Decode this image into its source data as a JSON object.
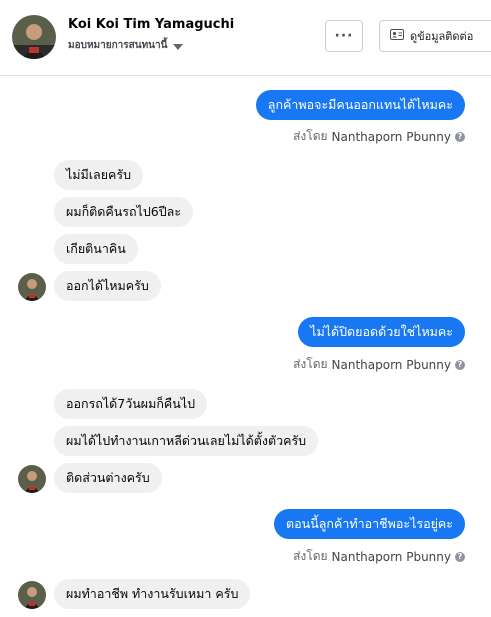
{
  "header": {
    "contact_name": "Koi Koi Tim Yamaguchi",
    "assign_label": "มอบหมายการสนทนานี้",
    "more_label": "···",
    "contact_info_label": "ดูข้อมูลติดต่อ",
    "more_icon": "ellipsis-icon",
    "contact_icon": "contact-card-icon"
  },
  "sent_by": {
    "prefix": "ส่งโดย",
    "agent": "Nanthaporn Pbunny",
    "info": "?"
  },
  "messages": [
    {
      "dir": "out",
      "text": "ลูกค้าพอจะมีคนออกแทนได้ไหมคะ"
    },
    {
      "dir": "in",
      "text": "ไม่มีเลยครับ"
    },
    {
      "dir": "in",
      "text": "ผมก็ติดคืนรถไป6ปีละ"
    },
    {
      "dir": "in",
      "text": "เกียตินาคิน"
    },
    {
      "dir": "in",
      "text": "ออกได้ไหมครับ"
    },
    {
      "dir": "out",
      "text": "ไม่ได้ปิดยอดด้วยใช่ไหมคะ"
    },
    {
      "dir": "in",
      "text": "ออกรถได้7วันผมก็คืนไป"
    },
    {
      "dir": "in",
      "text": "ผมได้ไปทำงานเกาหลีด่วนเลยไม่ได้ตั้งตัวครับ"
    },
    {
      "dir": "in",
      "text": "ติดส่วนต่างครับ"
    },
    {
      "dir": "out",
      "text": "ตอนนี้ลูกค้าทำอาชีพอะไรอยู่คะ"
    },
    {
      "dir": "in",
      "text": "ผมทำอาชีพ  ทำงานรับเหมา ครับ"
    }
  ],
  "colors": {
    "outgoing": "#1877f2",
    "incoming": "#f0f0f0",
    "meta_text": "#65676b"
  }
}
